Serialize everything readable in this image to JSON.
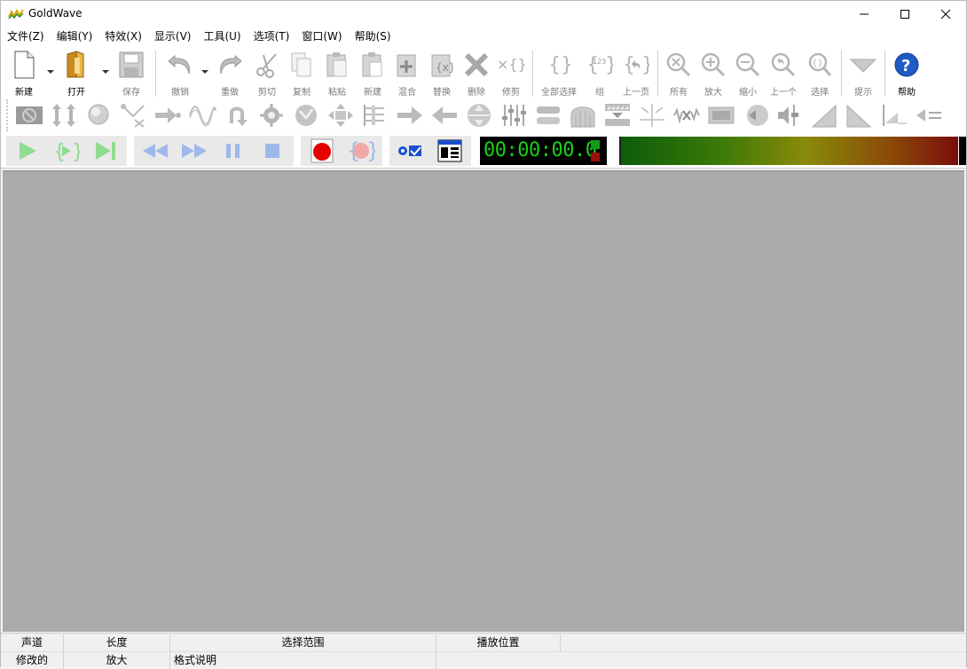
{
  "window": {
    "title": "GoldWave"
  },
  "window_controls": {
    "minimize": "—",
    "maximize": "☐",
    "close": "✕"
  },
  "menu": [
    "文件(Z)",
    "编辑(Y)",
    "特效(X)",
    "显示(V)",
    "工具(U)",
    "选项(T)",
    "窗口(W)",
    "帮助(S)"
  ],
  "toolbar_main": [
    {
      "label": "新建",
      "icon": "new-file-icon",
      "enabled": true
    },
    {
      "label": "打开",
      "icon": "open-folder-icon",
      "enabled": true
    },
    {
      "label": "保存",
      "icon": "save-icon",
      "enabled": false
    },
    {
      "label": "撤销",
      "icon": "undo-icon",
      "enabled": false
    },
    {
      "label": "重做",
      "icon": "redo-icon",
      "enabled": false
    },
    {
      "label": "剪切",
      "icon": "cut-icon",
      "enabled": false
    },
    {
      "label": "复制",
      "icon": "copy-icon",
      "enabled": false
    },
    {
      "label": "粘贴",
      "icon": "paste-icon",
      "enabled": false
    },
    {
      "label": "新建",
      "icon": "paste-new-icon",
      "enabled": false
    },
    {
      "label": "混合",
      "icon": "mix-icon",
      "enabled": false
    },
    {
      "label": "替换",
      "icon": "replace-icon",
      "enabled": false
    },
    {
      "label": "删除",
      "icon": "delete-icon",
      "enabled": false
    },
    {
      "label": "修剪",
      "icon": "trim-icon",
      "enabled": false
    },
    {
      "label": "全部选择",
      "icon": "select-all-icon",
      "enabled": false
    },
    {
      "label": "组",
      "icon": "group-icon",
      "enabled": false
    },
    {
      "label": "上一页",
      "icon": "previous-page-icon",
      "enabled": false
    },
    {
      "label": "所有",
      "icon": "zoom-all-icon",
      "enabled": false
    },
    {
      "label": "放大",
      "icon": "zoom-in-icon",
      "enabled": false
    },
    {
      "label": "缩小",
      "icon": "zoom-out-icon",
      "enabled": false
    },
    {
      "label": "上一个",
      "icon": "zoom-previous-icon",
      "enabled": false
    },
    {
      "label": "选择",
      "icon": "zoom-selection-icon",
      "enabled": false
    },
    {
      "label": "提示",
      "icon": "cue-icon",
      "enabled": false
    },
    {
      "label": "帮助",
      "icon": "help-icon",
      "enabled": true
    }
  ],
  "toolbar_effects": [
    "auto-gain-icon",
    "compressor-icon",
    "doppler-icon",
    "dynamics-icon",
    "echo-icon",
    "flanger-icon",
    "invert-icon",
    "mechanize-icon",
    "noise-reduction-icon",
    "offset-icon",
    "parametric-eq-icon",
    "pitch-icon",
    "reverse-icon",
    "resample-icon",
    "equalizer-icon",
    "playback-rate-icon",
    "spatial-icon",
    "time-warp-icon",
    "pop-click-icon",
    "silence-reduction-icon",
    "filter-icon",
    "volume-icon",
    "volume-adjust-icon",
    "fade-in-icon",
    "fade-out-icon",
    "volume-shape-icon",
    "match-volume-icon"
  ],
  "transport": {
    "timer": "00:00:00.0",
    "colors": {
      "play": "#8fdc8f",
      "playsel": "#8fdc8f",
      "record": "#e60000",
      "accent": "#1a4fd0"
    }
  },
  "status": {
    "row1": {
      "channel": "声道",
      "length": "长度",
      "selection": "选择范围",
      "position": "播放位置"
    },
    "row2": {
      "modified": "修改的",
      "zoom": "放大",
      "format": "格式说明"
    }
  }
}
